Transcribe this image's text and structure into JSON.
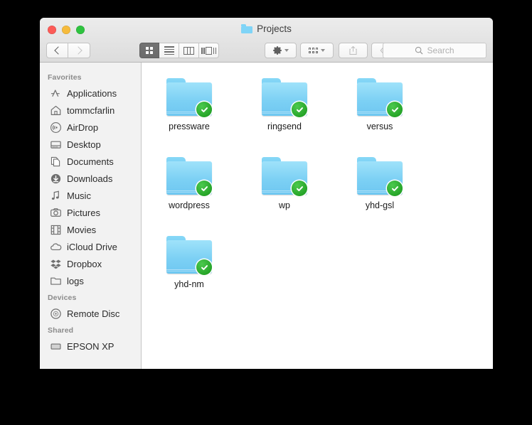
{
  "window": {
    "title": "Projects",
    "title_icon": "folder-icon",
    "traffic_lights": [
      {
        "name": "close",
        "color": "#fc5b57"
      },
      {
        "name": "minimize",
        "color": "#f6bb3c"
      },
      {
        "name": "zoom",
        "color": "#2ec33f"
      }
    ]
  },
  "toolbar": {
    "back": {
      "icon": "chevron-left-icon",
      "enabled": true
    },
    "forward": {
      "icon": "chevron-right-icon",
      "enabled": false
    },
    "view_modes": [
      {
        "name": "icon-view",
        "icon": "grid-icon",
        "active": true
      },
      {
        "name": "list-view",
        "icon": "list-icon",
        "active": false
      },
      {
        "name": "column-view",
        "icon": "columns-icon",
        "active": false
      },
      {
        "name": "coverflow-view",
        "icon": "coverflow-icon",
        "active": false
      }
    ],
    "action": {
      "name": "action-menu",
      "icon": "gear-icon",
      "enabled": true
    },
    "arrange": {
      "name": "arrange-menu",
      "icon": "arrange-icon",
      "enabled": true
    },
    "share": {
      "name": "share-button",
      "icon": "share-icon",
      "enabled": false
    },
    "tag": {
      "name": "tag-button",
      "icon": "tag-icon",
      "enabled": false
    }
  },
  "search": {
    "icon": "search-icon",
    "placeholder": "Search",
    "value": ""
  },
  "sidebar": {
    "sections": [
      {
        "header": "Favorites",
        "items": [
          {
            "label": "Applications",
            "icon": "applications-icon"
          },
          {
            "label": "tommcfarlin",
            "icon": "home-icon"
          },
          {
            "label": "AirDrop",
            "icon": "airdrop-icon"
          },
          {
            "label": "Desktop",
            "icon": "desktop-icon"
          },
          {
            "label": "Documents",
            "icon": "documents-icon"
          },
          {
            "label": "Downloads",
            "icon": "downloads-icon"
          },
          {
            "label": "Music",
            "icon": "music-icon"
          },
          {
            "label": "Pictures",
            "icon": "pictures-icon"
          },
          {
            "label": "Movies",
            "icon": "movies-icon"
          },
          {
            "label": "iCloud Drive",
            "icon": "cloud-icon"
          },
          {
            "label": "Dropbox",
            "icon": "dropbox-icon"
          },
          {
            "label": "logs",
            "icon": "folder-icon"
          }
        ]
      },
      {
        "header": "Devices",
        "items": [
          {
            "label": "Remote Disc",
            "icon": "disc-icon"
          }
        ]
      },
      {
        "header": "Shared",
        "items": [
          {
            "label": "EPSON XP",
            "icon": "printer-icon"
          }
        ]
      }
    ]
  },
  "content": {
    "view": "icon",
    "files": [
      {
        "name": "pressware",
        "kind": "folder",
        "badge": "green-check-badge"
      },
      {
        "name": "ringsend",
        "kind": "folder",
        "badge": "green-check-badge"
      },
      {
        "name": "versus",
        "kind": "folder",
        "badge": "green-check-badge"
      },
      {
        "name": "wordpress",
        "kind": "folder",
        "badge": "green-check-badge"
      },
      {
        "name": "wp",
        "kind": "folder",
        "badge": "green-check-badge"
      },
      {
        "name": "yhd-gsl",
        "kind": "folder",
        "badge": "green-check-badge"
      },
      {
        "name": "yhd-nm",
        "kind": "folder",
        "badge": "green-check-badge"
      }
    ]
  },
  "colors": {
    "folder_blue": "#7cd0f4",
    "badge_green": "#27a528",
    "sidebar_bg": "#f2f2f2",
    "titlebar_bg": "#e4e4e4"
  }
}
